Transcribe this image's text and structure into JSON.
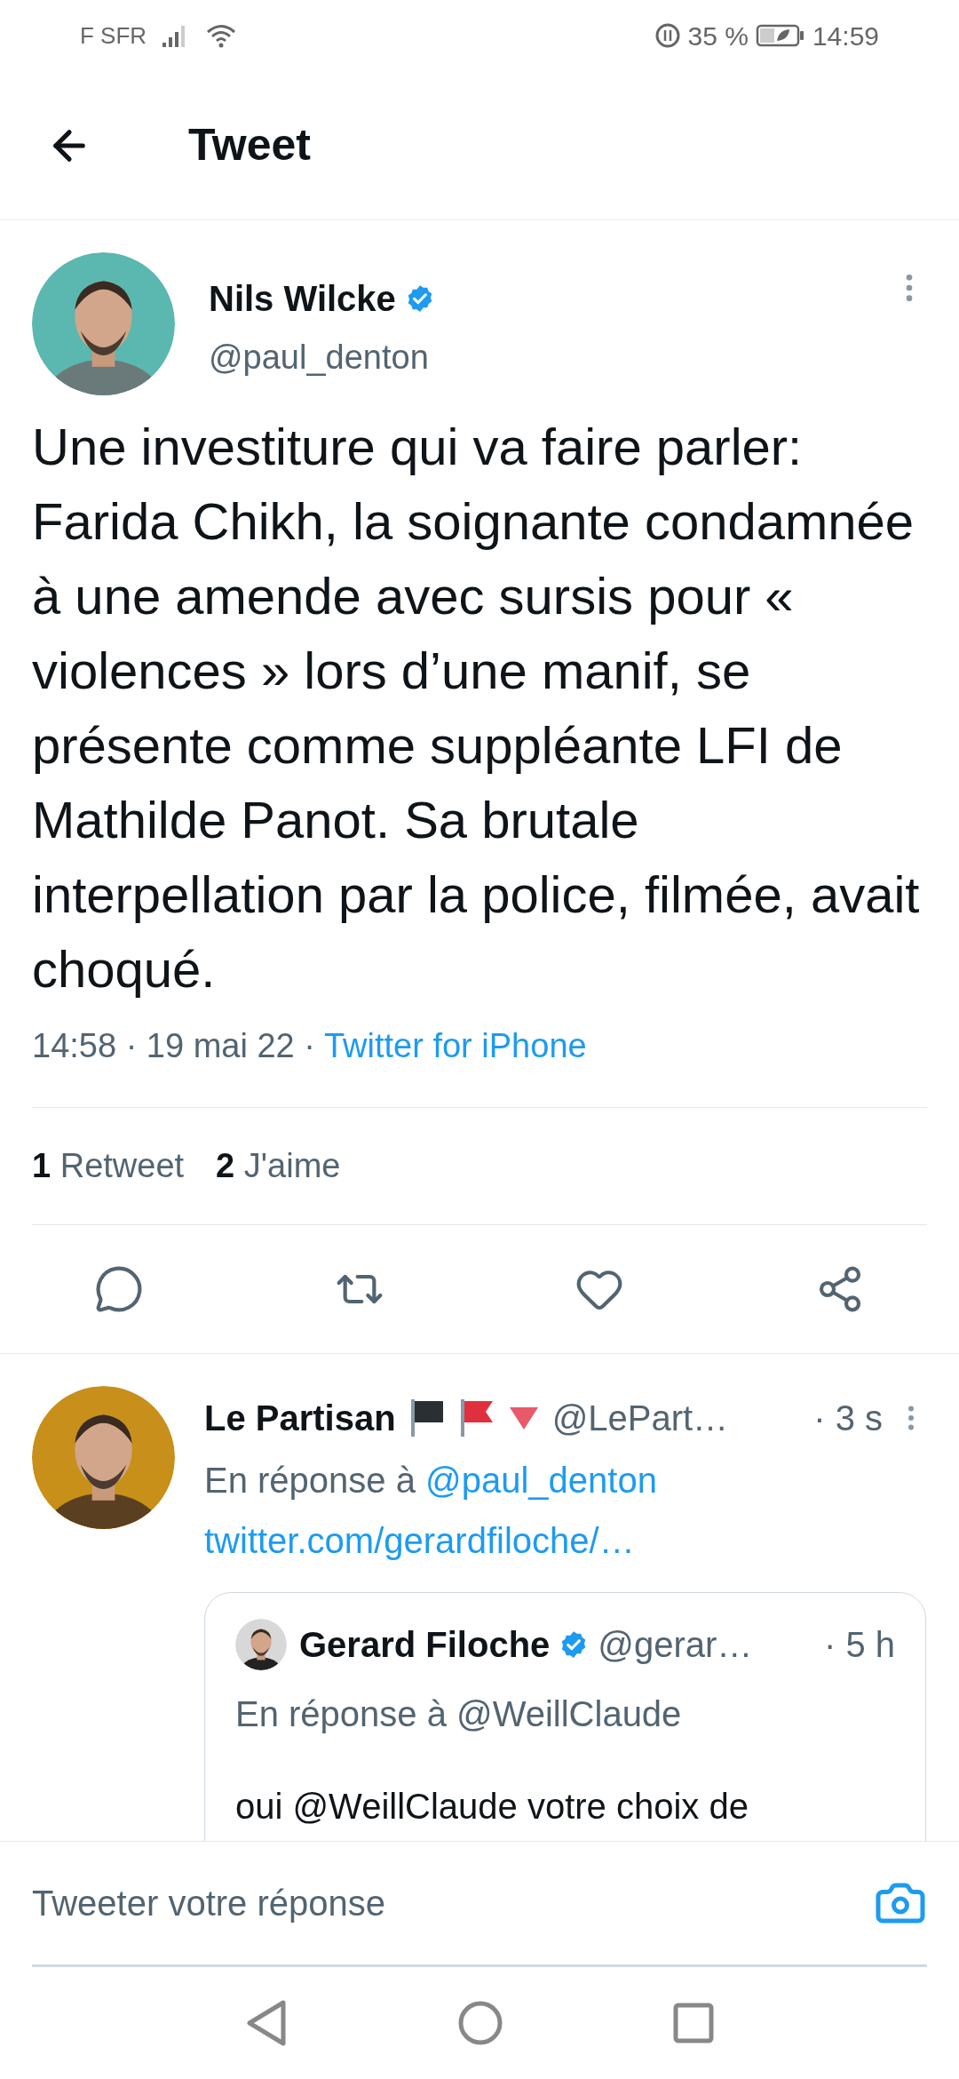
{
  "status_bar": {
    "carrier": "F SFR",
    "battery": "35 %",
    "time": "14:59"
  },
  "header": {
    "title": "Tweet"
  },
  "tweet": {
    "author": "Nils Wilcke",
    "verified": true,
    "handle": "@paul_denton",
    "text": "Une investiture qui va faire parler: Farida Chikh, la soignante condamnée à une amende avec sursis pour « violences » lors d’une manif, se présente comme suppléante LFI de Mathilde Panot. Sa brutale interpellation par la police, filmée, avait choqué.",
    "timestamp": "14:58 · 19 mai 22 ·",
    "source": "Twitter for iPhone",
    "stats": [
      "**1** Retweet",
      "**2** J'aime"
    ]
  },
  "reply": {
    "author": "Le Partisan",
    "handle": "@LePart…",
    "age": "· 3 s",
    "reply_prefix": "En réponse à",
    "reply_to": "@paul_denton",
    "link": "twitter.com/gerardfiloche/…",
    "quoted": {
      "author": "Gerard Filoche",
      "verified": true,
      "handle": "@gerar…",
      "age": "· 5 h",
      "reply_line": "En réponse à @WeillClaude",
      "text": "oui @WeillClaude votre choix de"
    }
  },
  "composer": {
    "placeholder": "Tweeter votre réponse"
  }
}
